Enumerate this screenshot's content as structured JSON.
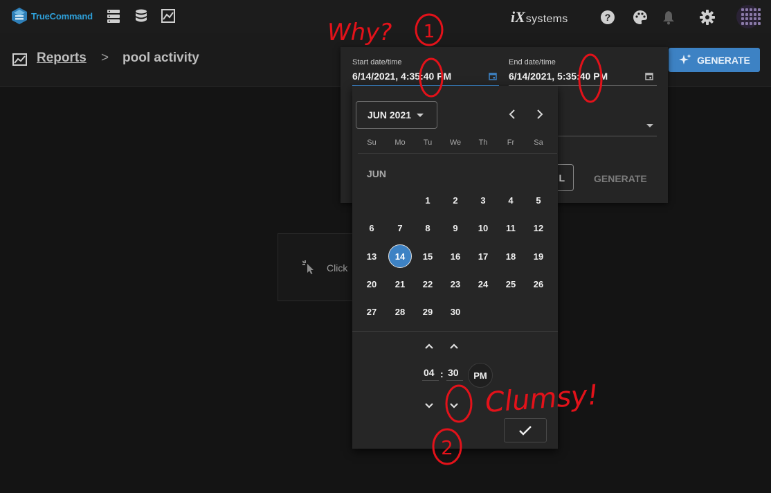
{
  "app": {
    "brand": "TrueCommand",
    "vendor_i": "iX",
    "vendor_rest": "systems"
  },
  "breadcrumb": {
    "parent": "Reports",
    "separator": ">",
    "current": "pool activity"
  },
  "toolbar": {
    "generate_label": "GENERATE"
  },
  "empty_state": {
    "text": "Click"
  },
  "form": {
    "start_label": "Start date/time",
    "start_value": "6/14/2021, 4:35:40 PM",
    "end_label": "End date/time",
    "end_value": "6/14/2021, 5:35:40 PM",
    "cancel_label": "L",
    "generate_label": "GENERATE"
  },
  "datepicker": {
    "period_label": "JUN 2021",
    "month_label": "JUN",
    "weekdays": [
      "Su",
      "Mo",
      "Tu",
      "We",
      "Th",
      "Fr",
      "Sa"
    ],
    "days": [
      "1",
      "2",
      "3",
      "4",
      "5",
      "6",
      "7",
      "8",
      "9",
      "10",
      "11",
      "12",
      "13",
      "14",
      "15",
      "16",
      "17",
      "18",
      "19",
      "20",
      "21",
      "22",
      "23",
      "24",
      "25",
      "26",
      "27",
      "28",
      "29",
      "30"
    ],
    "selected_day": "14",
    "hour": "04",
    "minute": "30",
    "colon": ":",
    "meridiem": "PM"
  },
  "annotations": {
    "note1": "Why?",
    "num1": "1",
    "note2": "Clumsy!",
    "num2": "2"
  },
  "colors": {
    "accent": "#3d82c4",
    "annotation": "#e3121a",
    "background": "#141414"
  }
}
